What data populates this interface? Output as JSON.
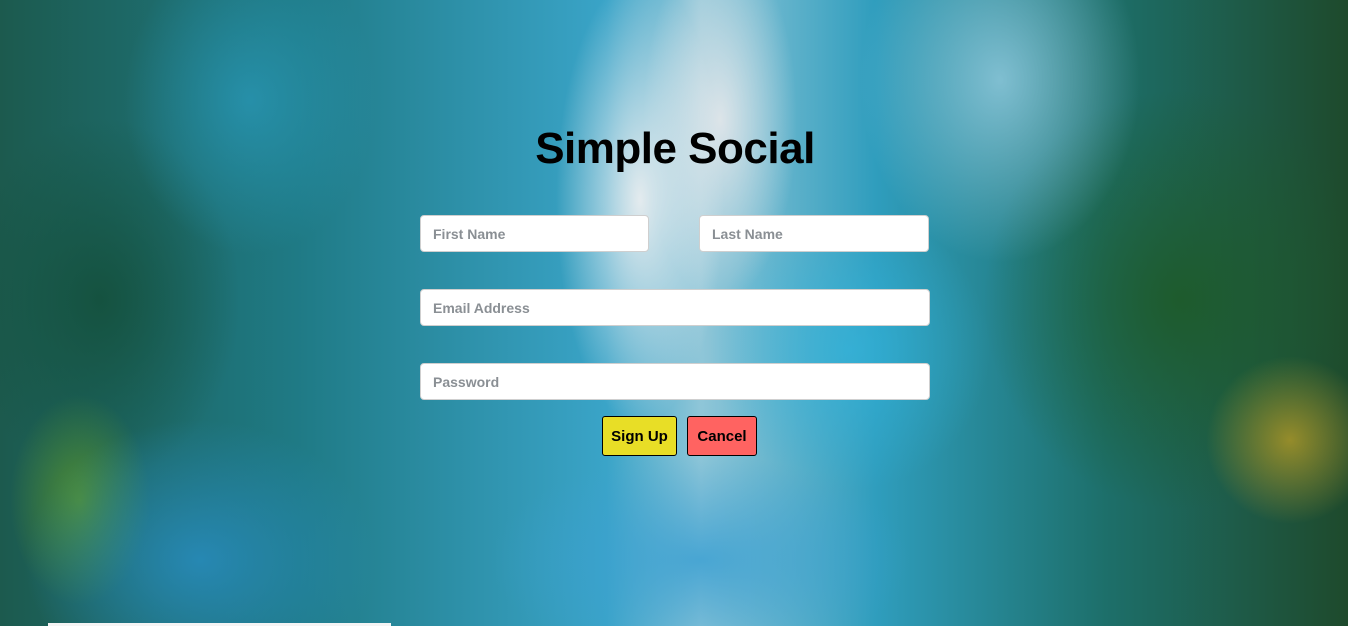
{
  "app": {
    "title": "Simple Social"
  },
  "form": {
    "first_name_placeholder": "First Name",
    "last_name_placeholder": "Last Name",
    "email_placeholder": "Email Address",
    "password_placeholder": "Password",
    "signup_label": "Sign Up",
    "cancel_label": "Cancel"
  },
  "colors": {
    "signup_button": "#e8de26",
    "cancel_button": "#ff6361",
    "title_text": "#000000"
  }
}
